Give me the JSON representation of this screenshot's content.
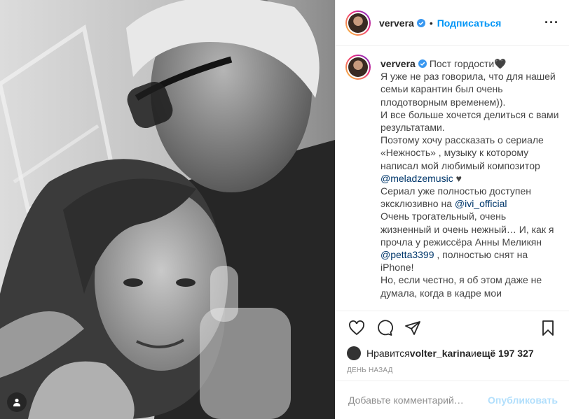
{
  "header": {
    "username": "ververa",
    "follow_label": "Подписаться",
    "dot": "•",
    "more_icon": "more-icon"
  },
  "caption": {
    "username": "ververa",
    "lines": {
      "l1": "Пост гордости🖤",
      "l2": "Я уже не раз говорила, что для нашей семьи карантин был очень плодотворным временем)).",
      "l3": "И все больше хочется делиться с вами результатами.",
      "l4a": "Поэтому хочу рассказать о сериале «Нежность» , музыку к которому написал мой любимый композитор ",
      "m1": "@meladzemusic",
      "l4b": " ♥",
      "l5a": "Сериал уже полностью доступен эксклюзивно на ",
      "m2": "@ivi_official",
      "l6a": "Очень трогательный, очень жизненный и очень нежный… И, как я прочла у режиссёра Анны Меликян ",
      "m3": "@petta3399",
      "l6b": " , полностью снят на iPhone!",
      "l7": "Но, если честно, я об этом даже не думала, когда в кадре мои"
    }
  },
  "actions": {
    "like_icon": "heart-icon",
    "comment_icon": "comment-icon",
    "share_icon": "share-icon",
    "save_icon": "bookmark-icon"
  },
  "likes": {
    "prefix": "Нравится ",
    "user": "volter_karina",
    "middle": " и ",
    "count": "ещё 197 327"
  },
  "date": "ДЕНЬ НАЗАД",
  "comment": {
    "placeholder": "Добавьте комментарий…",
    "publish_label": "Опубликовать"
  },
  "colors": {
    "accent": "#0095f6",
    "publish_disabled": "#b2dffc",
    "mention": "#00376b",
    "secondary_text": "#8e8e8e",
    "border": "#efefef"
  }
}
